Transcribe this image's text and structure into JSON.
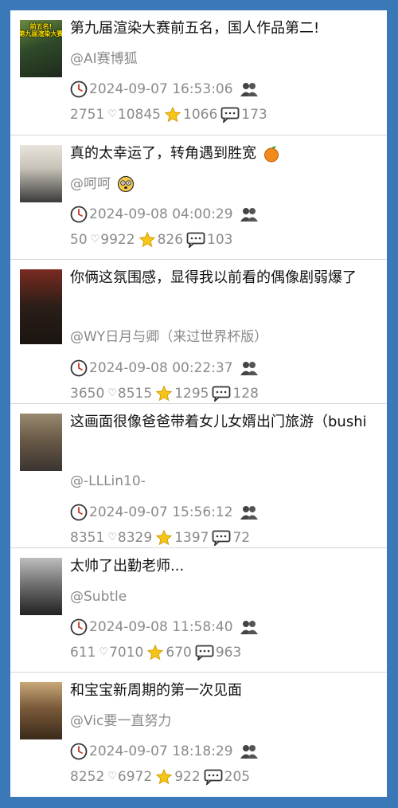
{
  "posts": [
    {
      "title": "第九届渲染大赛前五名，国人作品第二!",
      "user": "@AI赛博狐",
      "time": "2024-09-07 16:53:06",
      "plays": "2751",
      "likes": "10845",
      "stars": "1066",
      "comments": "173",
      "thumb_text_1": "前五名!",
      "thumb_text_2": "第九届渲染大赛",
      "thumb_colors": [
        "#2f4a2a",
        "#6b8a3e",
        "#1f2a1c"
      ]
    },
    {
      "title": "真的太幸运了，转角遇到胜宽",
      "user": "@呵呵",
      "time": "2024-09-08 04:00:29",
      "plays": "50",
      "likes": "9922",
      "stars": "826",
      "comments": "103",
      "thumb_colors": [
        "#c8c3b8",
        "#3a3a3a",
        "#e8e4dc"
      ]
    },
    {
      "title": "你俩这氛围感，显得我以前看的偶像剧弱爆了",
      "user": "@WY日月与卿（来过世界杯版）",
      "time": "2024-09-08 00:22:37",
      "plays": "3650",
      "likes": "8515",
      "stars": "1295",
      "comments": "128",
      "thumb_colors": [
        "#2a1e18",
        "#7a2a20",
        "#1a1410"
      ]
    },
    {
      "title": "这画面很像爸爸带着女儿女婿出门旅游（bushi",
      "user": "@-LLLin10-",
      "time": "2024-09-07 15:56:12",
      "plays": "8351",
      "likes": "8329",
      "stars": "1397",
      "comments": "72",
      "thumb_colors": [
        "#6a5a48",
        "#3a3430",
        "#9a8a70"
      ]
    },
    {
      "title": "太帅了出勤老师...",
      "user": "@Subtle",
      "time": "2024-09-08 11:58:40",
      "plays": "611",
      "likes": "7010",
      "stars": "670",
      "comments": "963",
      "thumb_colors": [
        "#bdbdbd",
        "#222222",
        "#6a6a6a"
      ]
    },
    {
      "title": "和宝宝新周期的第一次见面",
      "user": "@Vic要一直努力",
      "time": "2024-09-07 18:18:29",
      "plays": "8252",
      "likes": "6972",
      "stars": "922",
      "comments": "205",
      "thumb_colors": [
        "#7a5a3a",
        "#3a2a1a",
        "#c8a878"
      ]
    }
  ]
}
